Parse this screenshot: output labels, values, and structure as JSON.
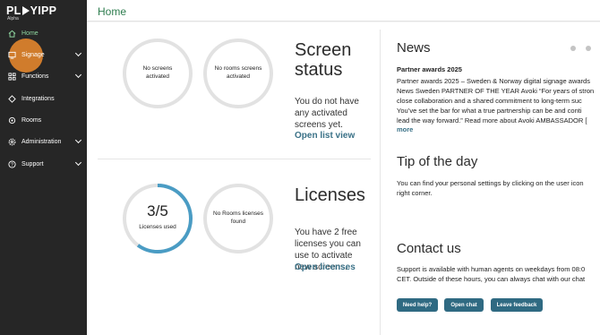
{
  "brand": {
    "logo_left": "PL",
    "logo_right": "YIPP",
    "subtitle": "Alpha"
  },
  "sidebar": {
    "items": [
      {
        "label": "Home"
      },
      {
        "label": "Signage"
      },
      {
        "label": "Functions"
      },
      {
        "label": "Integrations"
      },
      {
        "label": "Rooms"
      },
      {
        "label": "Administration"
      },
      {
        "label": "Support"
      }
    ]
  },
  "header": {
    "title": "Home"
  },
  "screen_status": {
    "screens_circle": "No screens activated",
    "rooms_circle": "No rooms screens activated",
    "title": "Screen status",
    "body": "You do not have any activated screens yet.",
    "link": "Open list view"
  },
  "licenses": {
    "used": "3/5",
    "used_label": "Licenses used",
    "used_fraction": 0.6,
    "rooms_circle": "No Rooms licenses found",
    "title": "Licenses",
    "body": "You have 2 free licenses you can use to activate new screens.",
    "link": "Open licenses"
  },
  "news": {
    "title": "News",
    "headline": "Partner awards 2025",
    "line1": "Partner awards 2025 – Sweden & Norway digital signage awards",
    "line2": "News Sweden PARTNER OF THE YEAR Avoki “For years of stron",
    "line3": "close collaboration and a shared commitment to long-term suc",
    "line4": "You’ve set the bar for what a true partnership can be and conti",
    "line5": "lead the way forward.” Read more about Avoki AMBASSADOR [",
    "more": "more"
  },
  "tip": {
    "title": "Tip of the day",
    "line1": "You can find your personal settings by clicking on the user icon",
    "line2": "right corner."
  },
  "contact": {
    "title": "Contact us",
    "line1": "Support is available with human agents on weekdays from 08:0",
    "line2": "CET. Outside of these hours, you can always chat with our chat",
    "buttons": {
      "help": "Need help?",
      "chat": "Open chat",
      "feedback": "Leave feedback"
    }
  },
  "colors": {
    "sidebar": "#262626",
    "accent_green": "#2e7d4f",
    "link_blue": "#3a7187",
    "button": "#2f6a82",
    "highlight": "#e8892e",
    "ring": "#4a9cc4"
  }
}
